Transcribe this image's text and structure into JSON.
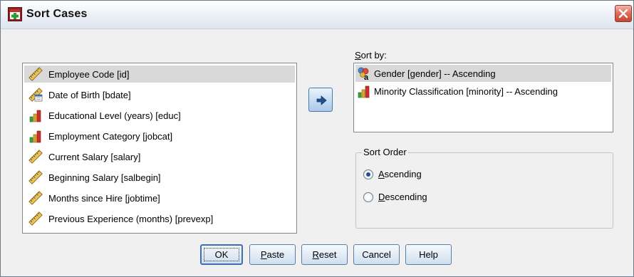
{
  "window": {
    "title": "Sort Cases",
    "colors": {
      "title_bar": "#e8eef5",
      "close_button": "#d9573f",
      "selection": "#d9d9d9",
      "accent": "#3c6fb5"
    }
  },
  "variables": {
    "items": [
      {
        "label": "Employee Code [id]",
        "icon": "scale-ruler-icon",
        "selected": true
      },
      {
        "label": "Date of Birth [bdate]",
        "icon": "date-ruler-icon",
        "selected": false
      },
      {
        "label": "Educational Level (years) [educ]",
        "icon": "ordinal-bar-icon",
        "selected": false
      },
      {
        "label": "Employment Category [jobcat]",
        "icon": "ordinal-bar-icon",
        "selected": false
      },
      {
        "label": "Current Salary [salary]",
        "icon": "scale-ruler-icon",
        "selected": false
      },
      {
        "label": "Beginning Salary [salbegin]",
        "icon": "scale-ruler-icon",
        "selected": false
      },
      {
        "label": "Months since Hire [jobtime]",
        "icon": "scale-ruler-icon",
        "selected": false
      },
      {
        "label": "Previous Experience (months) [prevexp]",
        "icon": "scale-ruler-icon",
        "selected": false
      }
    ]
  },
  "move_button": {
    "icon": "arrow-right-icon"
  },
  "sort_by": {
    "label": "Sort by:",
    "items": [
      {
        "label": "Gender [gender] -- Ascending",
        "icon": "nominal-string-icon",
        "selected": true
      },
      {
        "label": "Minority Classification [minority] -- Ascending",
        "icon": "ordinal-bar-icon",
        "selected": false
      }
    ]
  },
  "sort_order": {
    "title": "Sort Order",
    "options": [
      {
        "label": "Ascending",
        "checked": true
      },
      {
        "label": "Descending",
        "checked": false
      }
    ]
  },
  "buttons": {
    "ok": "OK",
    "paste": "Paste",
    "reset": "Reset",
    "cancel": "Cancel",
    "help": "Help"
  }
}
